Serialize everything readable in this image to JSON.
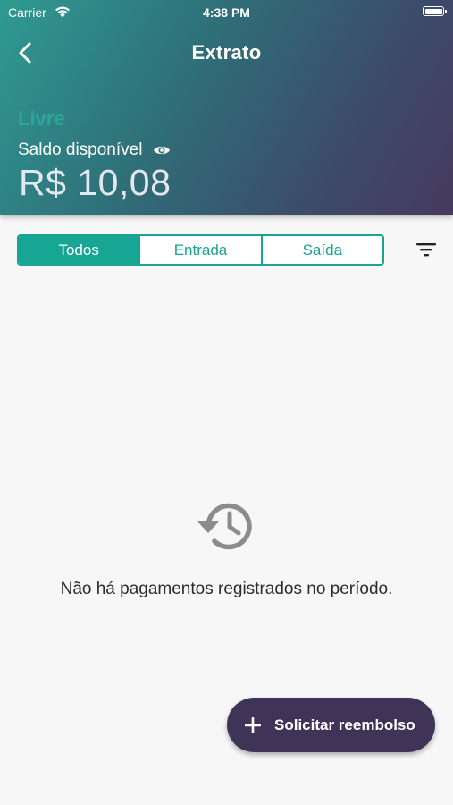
{
  "status_bar": {
    "carrier": "Carrier",
    "time": "4:38 PM",
    "wifi_icon": "wifi-icon",
    "battery_icon": "battery-full-icon"
  },
  "header": {
    "back_icon": "chevron-left-icon",
    "title": "Extrato",
    "account_type": "Livre",
    "balance_label": "Saldo disponível",
    "visibility_icon": "eye-icon",
    "balance_value": "R$ 10,08"
  },
  "tabs": [
    {
      "label": "Todos",
      "active": true
    },
    {
      "label": "Entrada",
      "active": false
    },
    {
      "label": "Saída",
      "active": false
    }
  ],
  "filter_icon": "filter-icon",
  "empty_state": {
    "icon": "history-icon",
    "message": "Não há pagamentos registrados no período."
  },
  "fab": {
    "icon": "plus-icon",
    "label": "Solicitar reembolso"
  },
  "colors": {
    "accent": "#1aa393",
    "fab": "#3f3358",
    "header_start": "#2f9a92",
    "header_end": "#473a5e"
  }
}
